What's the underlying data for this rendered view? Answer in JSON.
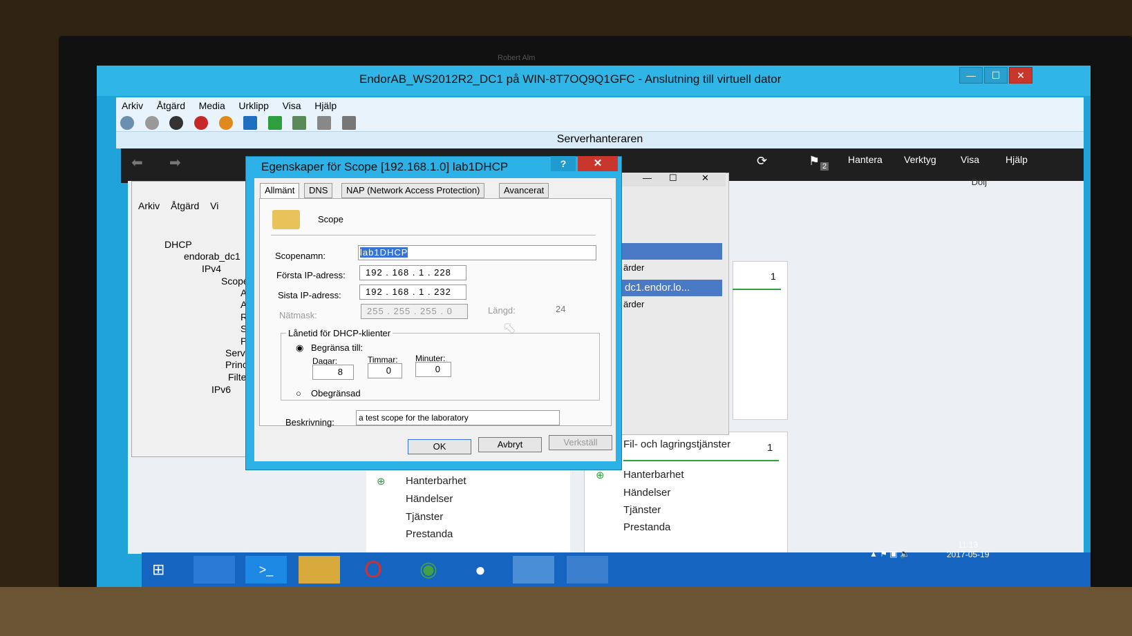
{
  "bezel_label": "Robert Alm",
  "vm_window": {
    "title": "EndorAB_WS2012R2_DC1 på WIN-8T7OQ9Q1GFC - Anslutning till virtuell dator",
    "menu": [
      "Arkiv",
      "Åtgärd",
      "Media",
      "Urklipp",
      "Visa",
      "Hjälp"
    ],
    "min": "—",
    "max": "☐",
    "close": "✕"
  },
  "server_manager": {
    "title": "Serverhanteraren",
    "menu": [
      "Hantera",
      "Verktyg",
      "Visa",
      "Hjälp"
    ],
    "flag_count": "2",
    "hide": "Dölj"
  },
  "mmc": {
    "menu": [
      "Arkiv",
      "Åtgärd",
      "Vi"
    ],
    "tree": [
      "DHCP",
      "endorab_dc1",
      "IPv4",
      "Scope",
      "Ad",
      "Ad",
      "Re",
      "Sc",
      "Pr",
      "Server",
      "Princi",
      "Filter",
      "IPv6"
    ]
  },
  "dialog": {
    "title": "Egenskaper för Scope [192.168.1.0] lab1DHCP",
    "help": "?",
    "close": "✕",
    "tabs": [
      "Allmänt",
      "DNS",
      "NAP (Network Access Protection)",
      "Avancerat"
    ],
    "header": "Scope",
    "scope_name_label": "Scopenamn:",
    "scope_name": "lab1DHCP",
    "first_ip_label": "Första IP-adress:",
    "first_ip": "192 . 168 .   1  . 228",
    "last_ip_label": "Sista IP-adress:",
    "last_ip": "192 . 168 .   1  . 232",
    "mask_label": "Nätmask:",
    "mask": "255 . 255 . 255 .  0",
    "length_label": "Längd:",
    "length": "24",
    "lease_group": "Lånetid för DHCP-klienter",
    "limit_label": "Begränsa till:",
    "days_label": "Dagar:",
    "days": "8",
    "hours_label": "Timmar:",
    "hours": "0",
    "minutes_label": "Minuter:",
    "minutes": "0",
    "unlimited_label": "Obegränsad",
    "desc_label": "Beskrivning:",
    "description": "a test scope for the laboratory",
    "ok": "OK",
    "cancel": "Avbryt",
    "apply": "Verkställ"
  },
  "side_panel": {
    "row1": "ärder",
    "row2": "dc1.endor.lo...",
    "row3": "ärder",
    "count1": "1",
    "count2": "1",
    "file_services": "Fil- och lagringstjänster"
  },
  "tiles": {
    "left": [
      "Hanterbarhet",
      "Händelser",
      "Tjänster",
      "Prestanda"
    ],
    "right": [
      "Hanterbarhet",
      "Händelser",
      "Tjänster",
      "Prestanda"
    ]
  },
  "taskbar": {
    "time": "11:13",
    "date": "2017-05-19"
  }
}
